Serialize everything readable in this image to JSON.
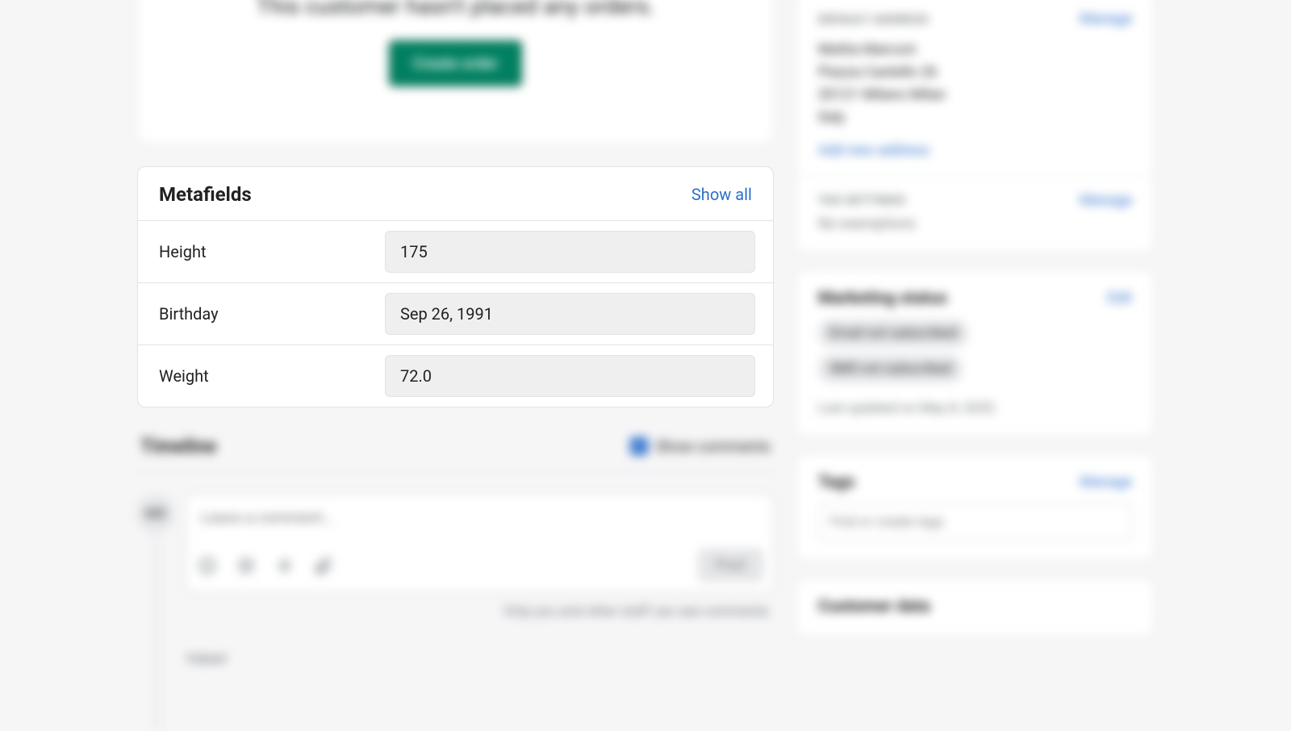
{
  "orders": {
    "empty_text": "This customer hasn't placed any orders.",
    "create_button": "Create order"
  },
  "metafields": {
    "title": "Metafields",
    "show_all": "Show all",
    "rows": [
      {
        "label": "Height",
        "value": "175"
      },
      {
        "label": "Birthday",
        "value": "Sep 26, 1991"
      },
      {
        "label": "Weight",
        "value": "72.0"
      }
    ]
  },
  "timeline": {
    "title": "Timeline",
    "show_comments_label": "Show comments",
    "avatar_initials": "MD",
    "comment_placeholder": "Leave a comment...",
    "post_label": "Post",
    "visibility_note": "Only you and other staff can see comments",
    "today_label": "TODAY"
  },
  "address": {
    "section_title": "DEFAULT ADDRESS",
    "manage": "Manage",
    "name": "Mattia Marconi",
    "street": "Piazza Castello 26",
    "city": "20121 Milano Milan",
    "country": "Italy",
    "add_new": "Add new address"
  },
  "tax": {
    "section_title": "TAX SETTINGS",
    "manage": "Manage",
    "status": "No exemptions"
  },
  "marketing": {
    "title": "Marketing status",
    "edit": "Edit",
    "badge_email": "Email not subscribed",
    "badge_sms": "SMS not subscribed",
    "last_updated": "Last updated on May 8, 2020."
  },
  "tags": {
    "title": "Tags",
    "manage": "Manage",
    "placeholder": "Find or create tags"
  },
  "customer_data": {
    "title": "Customer data"
  }
}
